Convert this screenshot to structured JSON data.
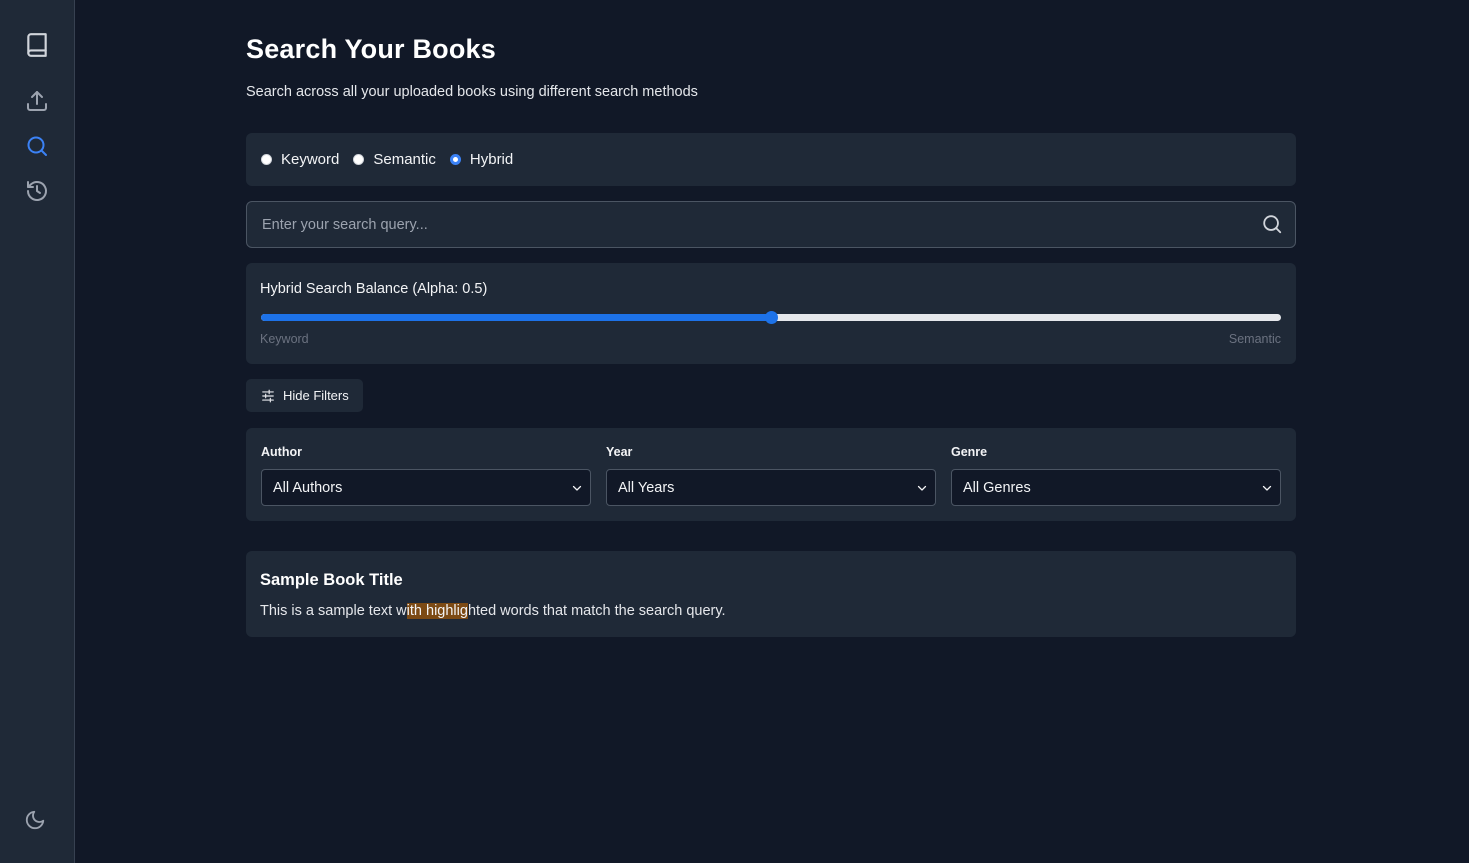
{
  "sidebar": {
    "items": [
      {
        "name": "books",
        "icon": "book-icon"
      },
      {
        "name": "upload",
        "icon": "upload-icon"
      },
      {
        "name": "search",
        "icon": "search-icon",
        "active": true
      },
      {
        "name": "history",
        "icon": "history-icon"
      }
    ],
    "theme_icon": "moon-icon"
  },
  "header": {
    "title": "Search Your Books",
    "subtitle": "Search across all your uploaded books using different search methods"
  },
  "search_mode": {
    "options": [
      "Keyword",
      "Semantic",
      "Hybrid"
    ],
    "selected": "Hybrid"
  },
  "search": {
    "placeholder": "Enter your search query...",
    "value": ""
  },
  "slider": {
    "label": "Hybrid Search Balance (Alpha: 0.5)",
    "value": 0.5,
    "min_label": "Keyword",
    "max_label": "Semantic"
  },
  "filters_toggle": {
    "label": "Hide Filters"
  },
  "filters": {
    "author": {
      "label": "Author",
      "value": "All Authors"
    },
    "year": {
      "label": "Year",
      "value": "All Years"
    },
    "genre": {
      "label": "Genre",
      "value": "All Genres"
    }
  },
  "result": {
    "title": "Sample Book Title",
    "text_before": "This is a sample text w",
    "highlight": "ith highlig",
    "text_after": "hted words that match the search query."
  },
  "colors": {
    "background": "#111827",
    "panel": "#1f2937",
    "accent": "#3b82f6",
    "highlight": "#7c4a14"
  }
}
